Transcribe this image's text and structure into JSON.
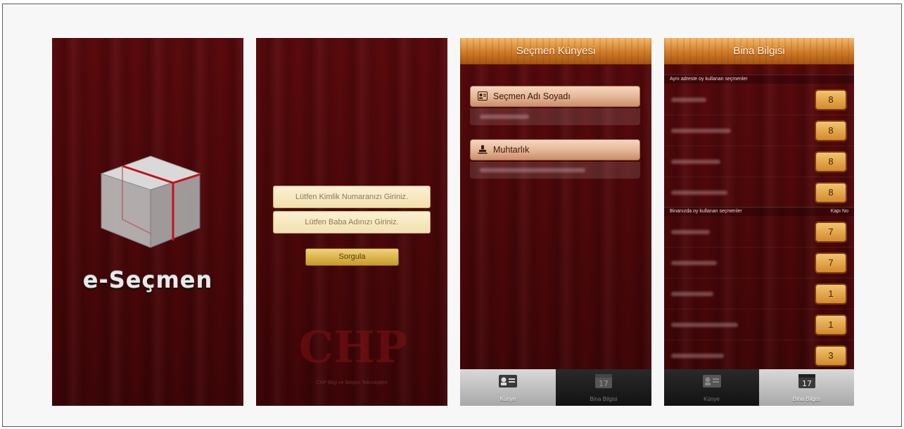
{
  "splash": {
    "app_name": "e-Seçmen"
  },
  "login": {
    "kimlik_placeholder": "Lütfen Kimlik Numaranızı Giriniz.",
    "baba_placeholder": "Lütfen Baba Adınızı Giriniz.",
    "submit_label": "Sorgula",
    "logo_text": "CHP",
    "footer_text": "CHP Bilgi ve İletişim Teknolojileri"
  },
  "kunye": {
    "title": "Seçmen Künyesi",
    "items": [
      {
        "label": "Seçmen Adı Soyadı",
        "icon": "id-card-icon"
      },
      {
        "label": "Muhtarlık",
        "icon": "stamp-icon"
      }
    ],
    "tabs": [
      {
        "label": "Künye",
        "icon": "id-card-icon",
        "selected": true
      },
      {
        "label": "Bina Bilgisi",
        "icon": "calendar-17-icon",
        "badge": "17",
        "selected": false
      }
    ]
  },
  "bina": {
    "title": "Bina Bilgisi",
    "section_same_address": "Aynı adreste oy kullanan seçmenler",
    "section_building": "Binanızda oy kullanan seçmenler",
    "column_door": "Kapı No",
    "same_address_doors": [
      "8",
      "8",
      "8",
      "8"
    ],
    "building_doors": [
      "7",
      "7",
      "1",
      "1",
      "3"
    ],
    "tabs": [
      {
        "label": "Künye",
        "icon": "id-card-icon",
        "selected": false
      },
      {
        "label": "Bina Bilgisi",
        "icon": "calendar-17-icon",
        "badge": "17",
        "selected": true
      }
    ]
  },
  "colors": {
    "curtain": "#4a0709",
    "wood_bar": "#cf7b28",
    "number_badge": "#d38a2b",
    "field_bg": "#f2e0b0"
  }
}
